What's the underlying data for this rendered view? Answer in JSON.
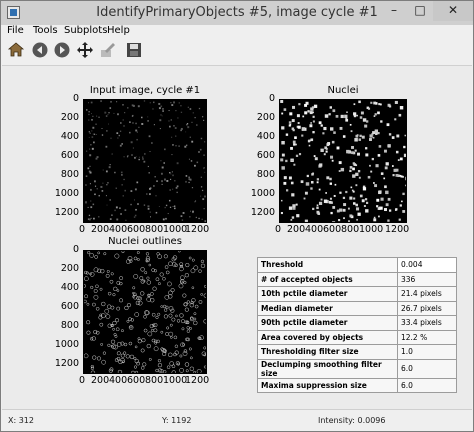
{
  "window": {
    "title": "IdentifyPrimaryObjects #5, image cycle #1"
  },
  "title_buttons": {
    "minimize": "–",
    "maximize": "□",
    "close": "✕"
  },
  "menu": {
    "items": [
      "File",
      "Tools",
      "Subplots",
      "Help"
    ]
  },
  "toolbar": {
    "icons": [
      "home-icon",
      "back-icon",
      "forward-icon",
      "pan-icon",
      "edit-axes-icon",
      "save-icon"
    ]
  },
  "plots": {
    "input": {
      "title": "Input image, cycle #1"
    },
    "nuclei": {
      "title": "Nuclei"
    },
    "outlines": {
      "title": "Nuclei outlines"
    },
    "y_ticks": [
      "0",
      "200",
      "400",
      "600",
      "800",
      "1000",
      "1200"
    ],
    "x_ticks": [
      "0",
      "200",
      "400",
      "600",
      "800",
      "1000",
      "1200"
    ]
  },
  "table": {
    "rows": [
      {
        "key": "Threshold",
        "value": "0.004"
      },
      {
        "key": "# of accepted objects",
        "value": "336"
      },
      {
        "key": "10th pctile diameter",
        "value": "21.4 pixels"
      },
      {
        "key": "Median diameter",
        "value": "26.7 pixels"
      },
      {
        "key": "90th pctile diameter",
        "value": "33.4 pixels"
      },
      {
        "key": "Area covered by objects",
        "value": "12.2 %"
      },
      {
        "key": "Thresholding filter size",
        "value": "1.0"
      },
      {
        "key": "Declumping smoothing filter size",
        "value": "6.0"
      },
      {
        "key": "Maxima suppression size",
        "value": "6.0"
      }
    ]
  },
  "status": {
    "x": "X: 312",
    "y": "Y: 1192",
    "intensity": "Intensity: 0.0096"
  }
}
